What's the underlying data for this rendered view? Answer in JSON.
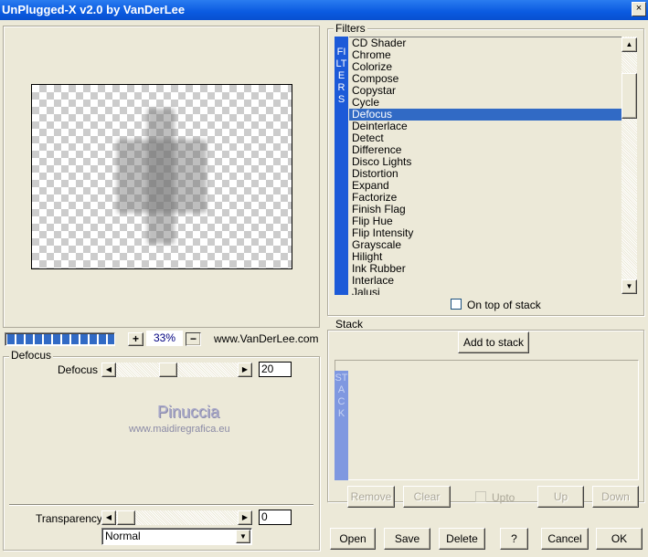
{
  "window": {
    "title": "UnPlugged-X v2.0 by VanDerLee",
    "close": "×"
  },
  "preview": {
    "progress": 1.0,
    "zoom_in": "+",
    "zoom": "33%",
    "zoom_out": "−",
    "url": "www.VanDerLee.com"
  },
  "params": {
    "group": "Defocus",
    "defocus_label": "Defocus",
    "defocus_value": "20",
    "defocus_range": [
      0,
      100
    ],
    "watermark_name": "Pinuccia",
    "watermark_url": "www.maidiregrafica.eu",
    "transparency_label": "Transparency",
    "transparency_value": "0",
    "blend_mode": "Normal"
  },
  "filters": {
    "group": "Filters",
    "strip": "FILTERS",
    "selected": "Defocus",
    "items": [
      "CD Shader",
      "Chrome",
      "Colorize",
      "Compose",
      "Copystar",
      "Cycle",
      "Defocus",
      "Deinterlace",
      "Detect",
      "Difference",
      "Disco Lights",
      "Distortion",
      "Expand",
      "Factorize",
      "Finish Flag",
      "Flip Hue",
      "Flip Intensity",
      "Grayscale",
      "Hilight",
      "Ink Rubber",
      "Interlace",
      "Jalusi"
    ],
    "on_top_label": "On top of stack"
  },
  "stack": {
    "group": "Stack",
    "strip": "STACK",
    "add": "Add to stack",
    "remove": "Remove",
    "clear": "Clear",
    "upto": "Upto",
    "up": "Up",
    "down": "Down"
  },
  "footer": {
    "open": "Open",
    "save": "Save",
    "delete": "Delete",
    "help": "?",
    "cancel": "Cancel",
    "ok": "OK"
  },
  "colors": {
    "title": "#0a5ae0",
    "selection": "#316ac5",
    "filters_strip": "#1c5ad8",
    "stack_strip": "#7f98e0"
  }
}
